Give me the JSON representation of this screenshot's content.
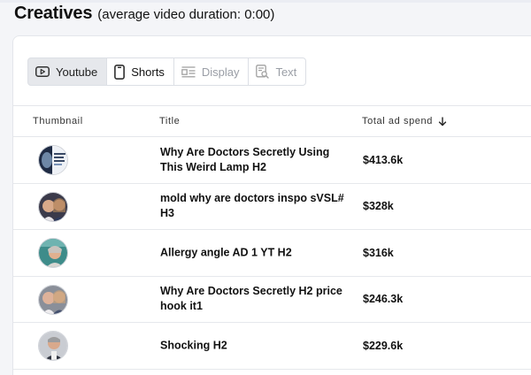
{
  "heading": {
    "title": "Creatives",
    "subtitle": "(average video duration: 0:00)"
  },
  "tabs": [
    {
      "label": "Youtube",
      "icon": "play-video-icon",
      "state": "active"
    },
    {
      "label": "Shorts",
      "icon": "phone-icon",
      "state": "enabled"
    },
    {
      "label": "Display",
      "icon": "display-layout-icon",
      "state": "disabled"
    },
    {
      "label": "Text",
      "icon": "text-search-icon",
      "state": "disabled"
    }
  ],
  "table": {
    "columns": {
      "thumbnail": "Thumbnail",
      "title": "Title",
      "spend": "Total ad spend"
    },
    "sort_icon": "arrow-down-icon",
    "rows": [
      {
        "title": "Why Are Doctors Secretly Using This Weird Lamp H2",
        "spend": "$413.6k"
      },
      {
        "title": "mold why are doctors inspo sVSL# H3",
        "spend": "$328k"
      },
      {
        "title": "Allergy angle AD 1 YT H2",
        "spend": "$316k"
      },
      {
        "title": "Why Are Doctors Secretly H2 price hook it1",
        "spend": "$246.3k"
      },
      {
        "title": "Shocking H2",
        "spend": "$229.6k"
      }
    ]
  },
  "colors": {
    "page_bg": "#f4f5f8",
    "card_bg": "#ffffff",
    "active_tab_bg": "#e6e8ec",
    "disabled_text": "#9a9ea6",
    "border": "#e4e6eb"
  }
}
